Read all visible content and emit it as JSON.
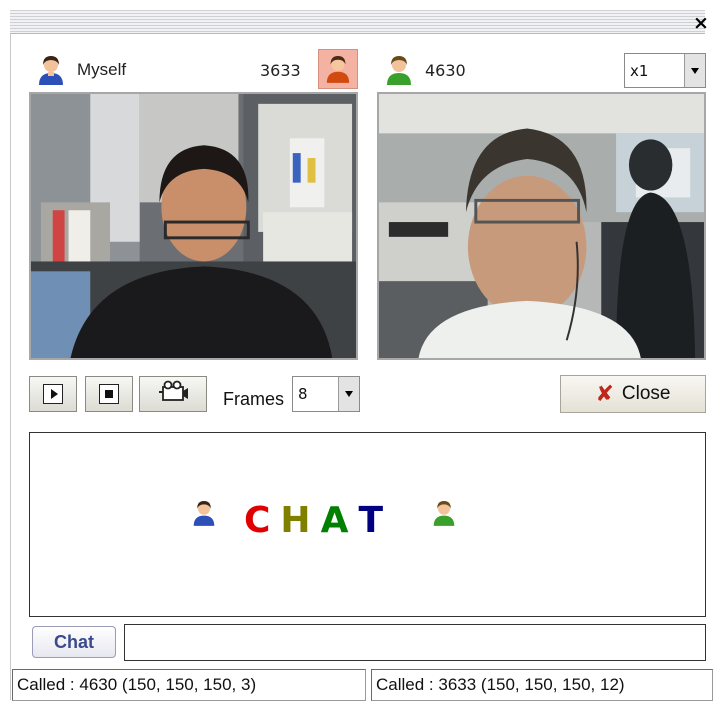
{
  "window": {
    "close_symbol": "×"
  },
  "local": {
    "label": "Myself",
    "number": "3633",
    "icon": "user-icon-blue",
    "number_icon": "user-icon-red"
  },
  "remote": {
    "number": "4630",
    "icon": "user-icon-green"
  },
  "zoom": {
    "value": "x1"
  },
  "controls": {
    "play_icon": "play-icon",
    "stop_icon": "stop-icon",
    "camera_icon": "camera-icon",
    "frames_label": "Frames",
    "frames_value": "8",
    "close_label": "Close"
  },
  "chat": {
    "letters": [
      "C",
      "H",
      "A",
      "T"
    ],
    "letter_colors": [
      "#e00000",
      "#808000",
      "#008000",
      "#000080"
    ],
    "button_label": "Chat",
    "input_value": "",
    "input_placeholder": ""
  },
  "status": {
    "left": "Called : 4630 (150, 150, 150, 3)",
    "right": "Called : 3633 (150, 150, 150, 12)"
  }
}
